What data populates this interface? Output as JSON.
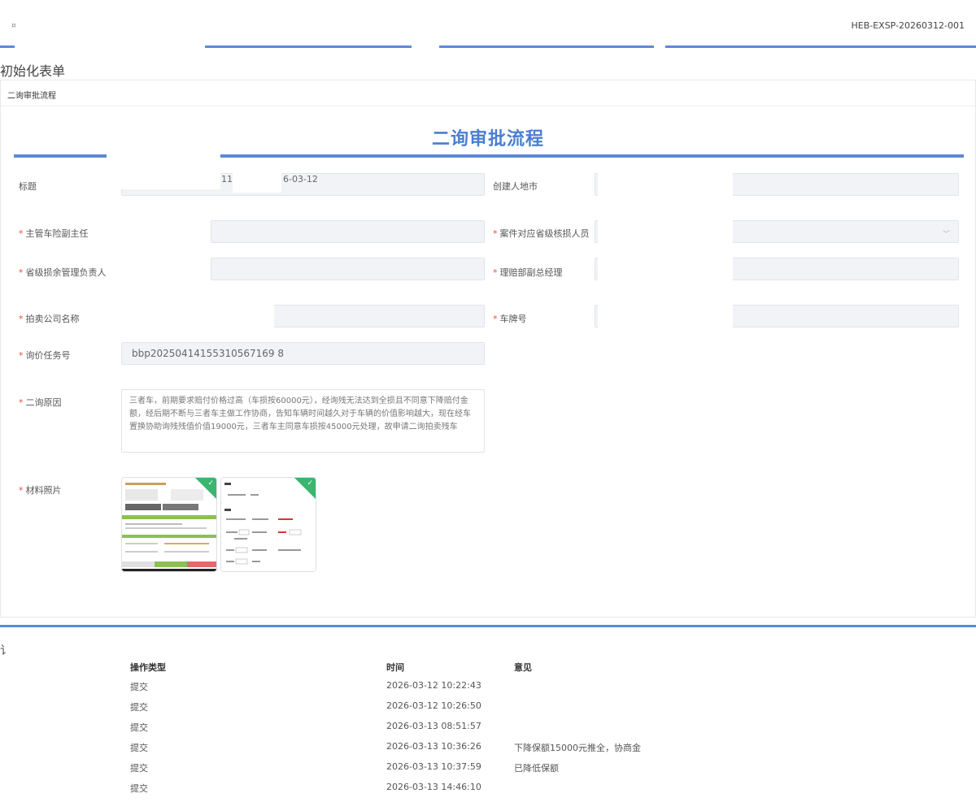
{
  "header": {
    "tiny_label": "¤",
    "document_number": "HEB-EXSP-20260312-001"
  },
  "section": {
    "title": "初始化表单",
    "tab_label": "二询审批流程"
  },
  "form": {
    "title": "二询审批流程",
    "fields": {
      "title_label": "标题",
      "title_value_part1": "11",
      "title_value_part2": "6-03-12",
      "creator_city_label": "创建人地市",
      "supervisor_label": "主管车险副主任",
      "province_reviewer_label": "案件对应省级核损人员",
      "province_manager_label": "省级损余管理负责人",
      "claims_deputy_label": "理赔部副总经理",
      "auction_company_label": "拍卖公司名称",
      "plate_label": "车牌号",
      "inquiry_task_label": "询价任务号",
      "inquiry_task_value": "bbp20250414155310567169 8",
      "second_reason_label": "二询原因",
      "second_reason_text": "三者车，前期要求赔付价格过高（车损按60000元），经询残无法达到全损且不同意下降赔付金额，经后期不断与三者车主做工作协商，告知车辆时间越久对于车辆的价值影响越大，现在经车置换协助询残残值价值19000元，三者车主同意车损按45000元处理，故申请二询拍卖残车",
      "photos_label": "材料照片"
    }
  },
  "log": {
    "header_fragment": "讠",
    "columns": [
      "操作类型",
      "时间",
      "意见"
    ],
    "rows": [
      {
        "type": "提交",
        "time": "2026-03-12 10:22:43",
        "opinion": ""
      },
      {
        "type": "提交",
        "time": "2026-03-12 10:26:50",
        "opinion": ""
      },
      {
        "type": "提交",
        "time": "2026-03-13 08:51:57",
        "opinion": ""
      },
      {
        "type": "提交",
        "time": "2026-03-13 10:36:26",
        "opinion": "下降保额15000元推全，协商金"
      },
      {
        "type": "提交",
        "time": "2026-03-13 10:37:59",
        "opinion": "已降低保额"
      },
      {
        "type": "提交",
        "time": "2026-03-13 14:46:10",
        "opinion": ""
      }
    ]
  },
  "colors": {
    "accent": "#5b8ad6",
    "title_blue": "#4a7fd0",
    "required": "#e74c3c",
    "approved_green": "#3bb56f"
  }
}
